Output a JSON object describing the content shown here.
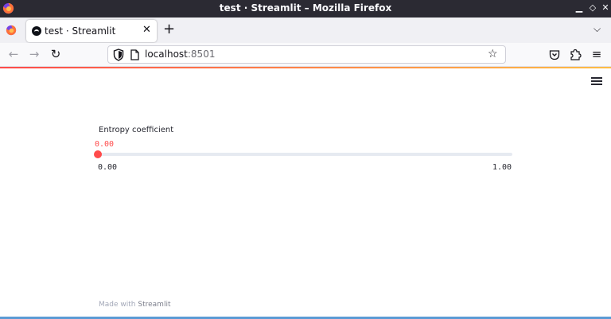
{
  "window": {
    "title": "test · Streamlit – Mozilla Firefox"
  },
  "tab": {
    "title": "test · Streamlit"
  },
  "navbar": {
    "url_host": "localhost",
    "url_port": ":8501"
  },
  "slider": {
    "label": "Entropy coefficient",
    "value": 0.0,
    "value_text": "0.00",
    "min_text": "0.00",
    "max_text": "1.00",
    "min": 0.0,
    "max": 1.0,
    "accent_color": "#ff4b4b"
  },
  "footer": {
    "prefix": "Made with",
    "brand": "Streamlit"
  },
  "icons": {
    "firefox": "firefox-logo-icon",
    "minimize": "minimize-icon",
    "maximize": "maximize-icon",
    "close": "close-icon",
    "new_tab": "plus-icon",
    "tab_list": "chevron-down-icon",
    "back": "arrow-left-icon",
    "forward": "arrow-right-icon",
    "reload": "reload-icon",
    "shield": "shield-icon",
    "page": "page-icon",
    "bookmark": "star-icon",
    "pocket": "pocket-icon",
    "extensions": "puzzle-icon",
    "app_menu": "hamburger-menu-icon",
    "streamlit_menu": "hamburger-menu-icon"
  }
}
